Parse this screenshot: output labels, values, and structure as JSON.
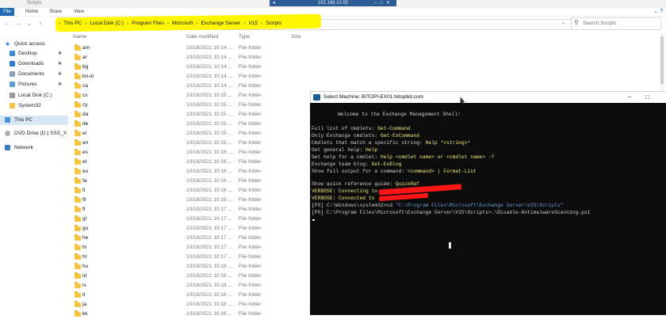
{
  "window": {
    "title": "Scripts",
    "remote_host": "192.168.10.55"
  },
  "ribbon": {
    "file": "File",
    "home": "Home",
    "share": "Share",
    "view": "View"
  },
  "breadcrumb": [
    "This PC",
    "Local Disk (C:)",
    "Program Files",
    "Microsoft",
    "Exchange Server",
    "V15",
    "Scripts"
  ],
  "search": {
    "placeholder": "Search Scripts"
  },
  "columns": {
    "name": "Name",
    "date": "Date modified",
    "type": "Type",
    "size": "Size"
  },
  "sidebar": {
    "items": [
      {
        "label": "Quick access",
        "icon": "star-icon"
      },
      {
        "label": "Desktop",
        "icon": "desktop-icon",
        "pinned": true
      },
      {
        "label": "Downloads",
        "icon": "downloads-icon",
        "pinned": true
      },
      {
        "label": "Documents",
        "icon": "documents-icon",
        "pinned": true
      },
      {
        "label": "Pictures",
        "icon": "pictures-icon",
        "pinned": true
      },
      {
        "label": "Local Disk (C:)",
        "icon": "drive-icon"
      },
      {
        "label": "System32",
        "icon": "folder-icon"
      },
      {
        "label": "This PC",
        "icon": "computer-icon"
      },
      {
        "label": "DVD Drive (D:) SSS_X",
        "icon": "dvd-icon"
      },
      {
        "label": "Network",
        "icon": "network-icon"
      }
    ]
  },
  "files": [
    {
      "name": "am",
      "date": "10/18/2021 10:14 ...",
      "type": "File folder"
    },
    {
      "name": "ar",
      "date": "10/18/2021 10:14 ...",
      "type": "File folder"
    },
    {
      "name": "bg",
      "date": "10/18/2021 10:14 ...",
      "type": "File folder"
    },
    {
      "name": "bn-in",
      "date": "10/18/2021 10:14 ...",
      "type": "File folder"
    },
    {
      "name": "ca",
      "date": "10/18/2021 10:14 ...",
      "type": "File folder"
    },
    {
      "name": "cs",
      "date": "10/18/2021 10:15 ...",
      "type": "File folder"
    },
    {
      "name": "cy",
      "date": "10/18/2021 10:15 ...",
      "type": "File folder"
    },
    {
      "name": "da",
      "date": "10/18/2021 10:15 ...",
      "type": "File folder"
    },
    {
      "name": "de",
      "date": "10/18/2021 10:15 ...",
      "type": "File folder"
    },
    {
      "name": "el",
      "date": "10/18/2021 10:15 ...",
      "type": "File folder"
    },
    {
      "name": "en",
      "date": "10/18/2021 10:15 ...",
      "type": "File folder"
    },
    {
      "name": "es",
      "date": "10/18/2021 10:16 ...",
      "type": "File folder"
    },
    {
      "name": "et",
      "date": "10/18/2021 10:16 ...",
      "type": "File folder"
    },
    {
      "name": "eu",
      "date": "10/18/2021 10:16 ...",
      "type": "File folder"
    },
    {
      "name": "fa",
      "date": "10/18/2021 10:16 ...",
      "type": "File folder"
    },
    {
      "name": "fi",
      "date": "10/18/2021 10:16 ...",
      "type": "File folder"
    },
    {
      "name": "fil",
      "date": "10/18/2021 10:16 ...",
      "type": "File folder"
    },
    {
      "name": "fr",
      "date": "10/18/2021 10:17 ...",
      "type": "File folder"
    },
    {
      "name": "gl",
      "date": "10/18/2021 10:17 ...",
      "type": "File folder"
    },
    {
      "name": "gu",
      "date": "10/18/2021 10:17 ...",
      "type": "File folder"
    },
    {
      "name": "he",
      "date": "10/18/2021 10:17 ...",
      "type": "File folder"
    },
    {
      "name": "hi",
      "date": "10/18/2021 10:17 ...",
      "type": "File folder"
    },
    {
      "name": "hr",
      "date": "10/18/2021 10:17 ...",
      "type": "File folder"
    },
    {
      "name": "hu",
      "date": "10/18/2021 10:18 ...",
      "type": "File folder"
    },
    {
      "name": "id",
      "date": "10/18/2021 10:18 ...",
      "type": "File folder"
    },
    {
      "name": "is",
      "date": "10/18/2021 10:18 ...",
      "type": "File folder"
    },
    {
      "name": "it",
      "date": "10/18/2021 10:18 ...",
      "type": "File folder"
    },
    {
      "name": "ja",
      "date": "10/18/2021 10:18 ...",
      "type": "File folder"
    },
    {
      "name": "kk",
      "date": "10/18/2021 10:18 ...",
      "type": "File folder"
    }
  ],
  "powershell": {
    "title": "Select Machine: BITOPI-EX01.bitopibd.com",
    "welcome": "Welcome to the Exchange Management Shell!",
    "lines": [
      {
        "a": "Full list of cmdlets: ",
        "b": "Get-Command"
      },
      {
        "a": "Only Exchange cmdlets: ",
        "b": "Get-ExCommand"
      },
      {
        "a": "Cmdlets that match a specific string: ",
        "b": "Help *<string>*"
      },
      {
        "a": "Get general help: ",
        "b": "Help"
      },
      {
        "a": "Get help for a cmdlet: ",
        "b": "Help <cmdlet name> or <cmdlet name> -?"
      },
      {
        "a": "Exchange team blog: ",
        "b": "Get-ExBlog"
      },
      {
        "a": "Show full output for a command: ",
        "b": "<command> | Format-List"
      },
      {
        "a": "Show quick reference guide: ",
        "b": "QuickRef"
      }
    ],
    "verbose1": "VERBOSE: Connecting to ",
    "verbose2": "VERBOSE: Connected to ",
    "cmd1_prompt": "[PS] C:\\Windows\\system32>cd ",
    "cmd1_arg": "\"C:\\Program Files\\Microsoft\\Exchange Server\\V15\\Scripts\"",
    "cmd2": "[PS] C:\\Program Files\\Microsoft\\Exchange Server\\V15\\Scripts>.\\Disable-AntimalwareScanning.ps1"
  },
  "colors": {
    "highlight": "#fff600",
    "redaction": "#ff1515",
    "console_bg": "#0c0c0c",
    "accent": "#1f6ab4"
  }
}
